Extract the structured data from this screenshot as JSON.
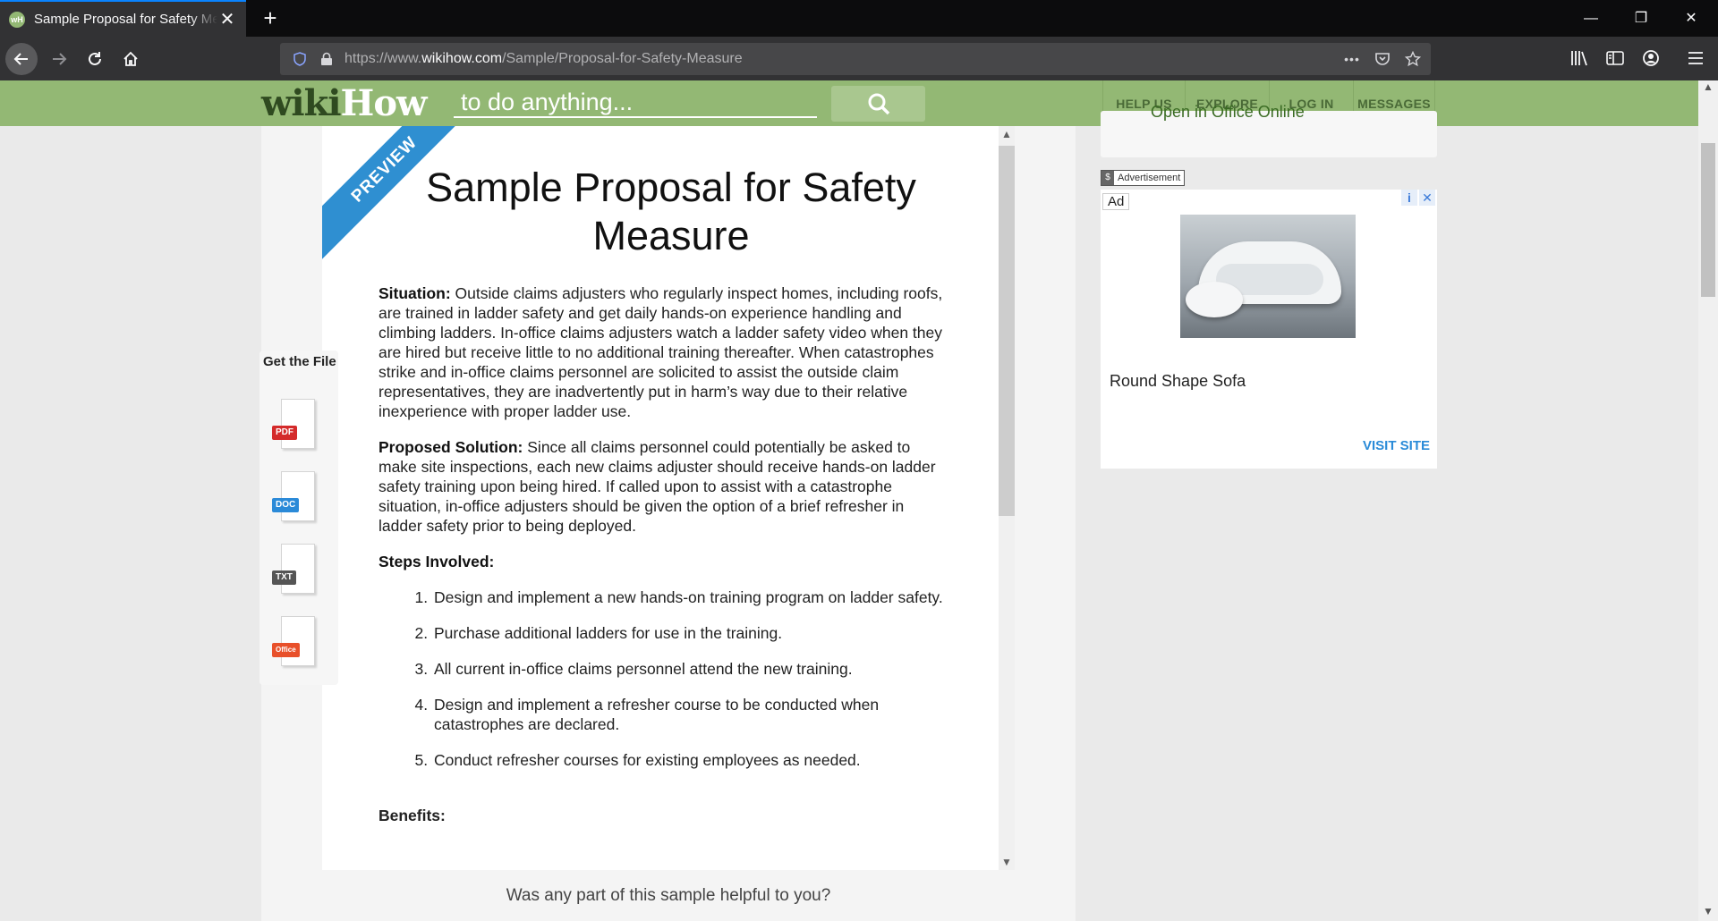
{
  "browser": {
    "tab_title": "Sample Proposal for Safety Measure",
    "new_tab_symbol": "+",
    "url_prefix": "https://www.",
    "url_host": "wikihow.com",
    "url_path": "/Sample/Proposal-for-Safety-Measure",
    "page_actions": "•••"
  },
  "header": {
    "logo_wiki": "wiki",
    "logo_how": "How",
    "search_placeholder": "to do anything...",
    "nav": [
      "HELP US",
      "EXPLORE",
      "LOG IN",
      "MESSAGES"
    ]
  },
  "document": {
    "ribbon": "PREVIEW",
    "title": "Sample Proposal for Safety Measure",
    "situation_label": "Situation:",
    "situation_text": " Outside claims adjusters who regularly inspect homes, including roofs, are trained in ladder safety and get daily hands-on experience handling and climbing ladders. In-office claims adjusters watch a ladder safety video when they are hired but receive little to no additional training thereafter. When catastrophes strike and in-office claims personnel are solicited to assist the outside claim representatives, they are inadvertently put in harm’s way due to their relative inexperience with proper ladder use.",
    "solution_label": "Proposed Solution:",
    "solution_text": " Since all claims personnel could potentially be asked to make site inspections, each new claims adjuster should receive hands-on ladder safety training upon being hired. If called upon to assist with a catastrophe situation, in-office adjusters should be given the option of a brief refresher in ladder safety prior to being deployed.",
    "steps_label": "Steps Involved:",
    "steps": [
      "Design and implement a new hands-on training program on ladder safety.",
      "Purchase additional ladders for use in the training.",
      "All current in-office claims personnel attend the new training.",
      "Design and implement a refresher course to be conducted when catastrophes are declared.",
      "Conduct refresher courses for existing employees as needed."
    ],
    "benefits_label": "Benefits:"
  },
  "file_panel": {
    "label": "Get the File",
    "files": [
      {
        "badge": "PDF",
        "color": "#d42a2a"
      },
      {
        "badge": "DOC",
        "color": "#2b8ad8"
      },
      {
        "badge": "TXT",
        "color": "#555555"
      },
      {
        "badge": "Office",
        "color": "#e8502a"
      }
    ]
  },
  "helpful_question": "Was any part of this sample helpful to you?",
  "right_column": {
    "open_online": "Open in Office Online",
    "ad_label": "Advertisement",
    "ad_tag": "Ad",
    "ad_title": "Round Shape Sofa",
    "ad_visit": "VISIT SITE"
  }
}
